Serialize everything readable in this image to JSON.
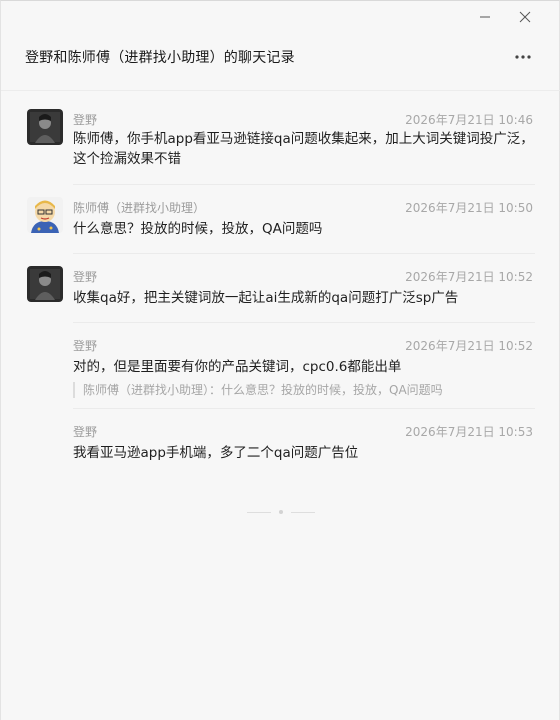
{
  "window": {
    "title": "登野和陈师傅（进群找小助理）的聊天记录",
    "controls": [
      "minimize-icon",
      "close-icon"
    ],
    "menu_icon": "more-icon"
  },
  "messages": [
    {
      "sender": "登野",
      "time": "2026年7月21日 10:46",
      "text": "陈师傅，你手机app看亚马逊链接qa问题收集起来，加上大词关键词投广泛，这个捡漏效果不错",
      "avatar": "dark-photo-avatar"
    },
    {
      "sender": "陈师傅（进群找小助理）",
      "time": "2026年7月21日 10:50",
      "text": "什么意思？投放的时候，投放，QA问题吗",
      "avatar": "cartoon-avatar"
    },
    {
      "sender": "登野",
      "time": "2026年7月21日 10:52",
      "text": "收集qa好，把主关键词放一起让ai生成新的qa问题打广泛sp广告",
      "avatar": "dark-photo-avatar"
    },
    {
      "sender": "登野",
      "time": "2026年7月21日 10:52",
      "text": "对的，但是里面要有你的产品关键词，cpc0.6都能出单",
      "quote": "陈师傅（进群找小助理）：什么意思？投放的时候，投放，QA问题吗"
    },
    {
      "sender": "登野",
      "time": "2026年7月21日 10:53",
      "text": "我看亚马逊app手机端，多了二个qa问题广告位"
    }
  ],
  "colors": {
    "background": "#f7f7f7",
    "text": "#1f1f1f",
    "meta": "#a8a8a8"
  }
}
